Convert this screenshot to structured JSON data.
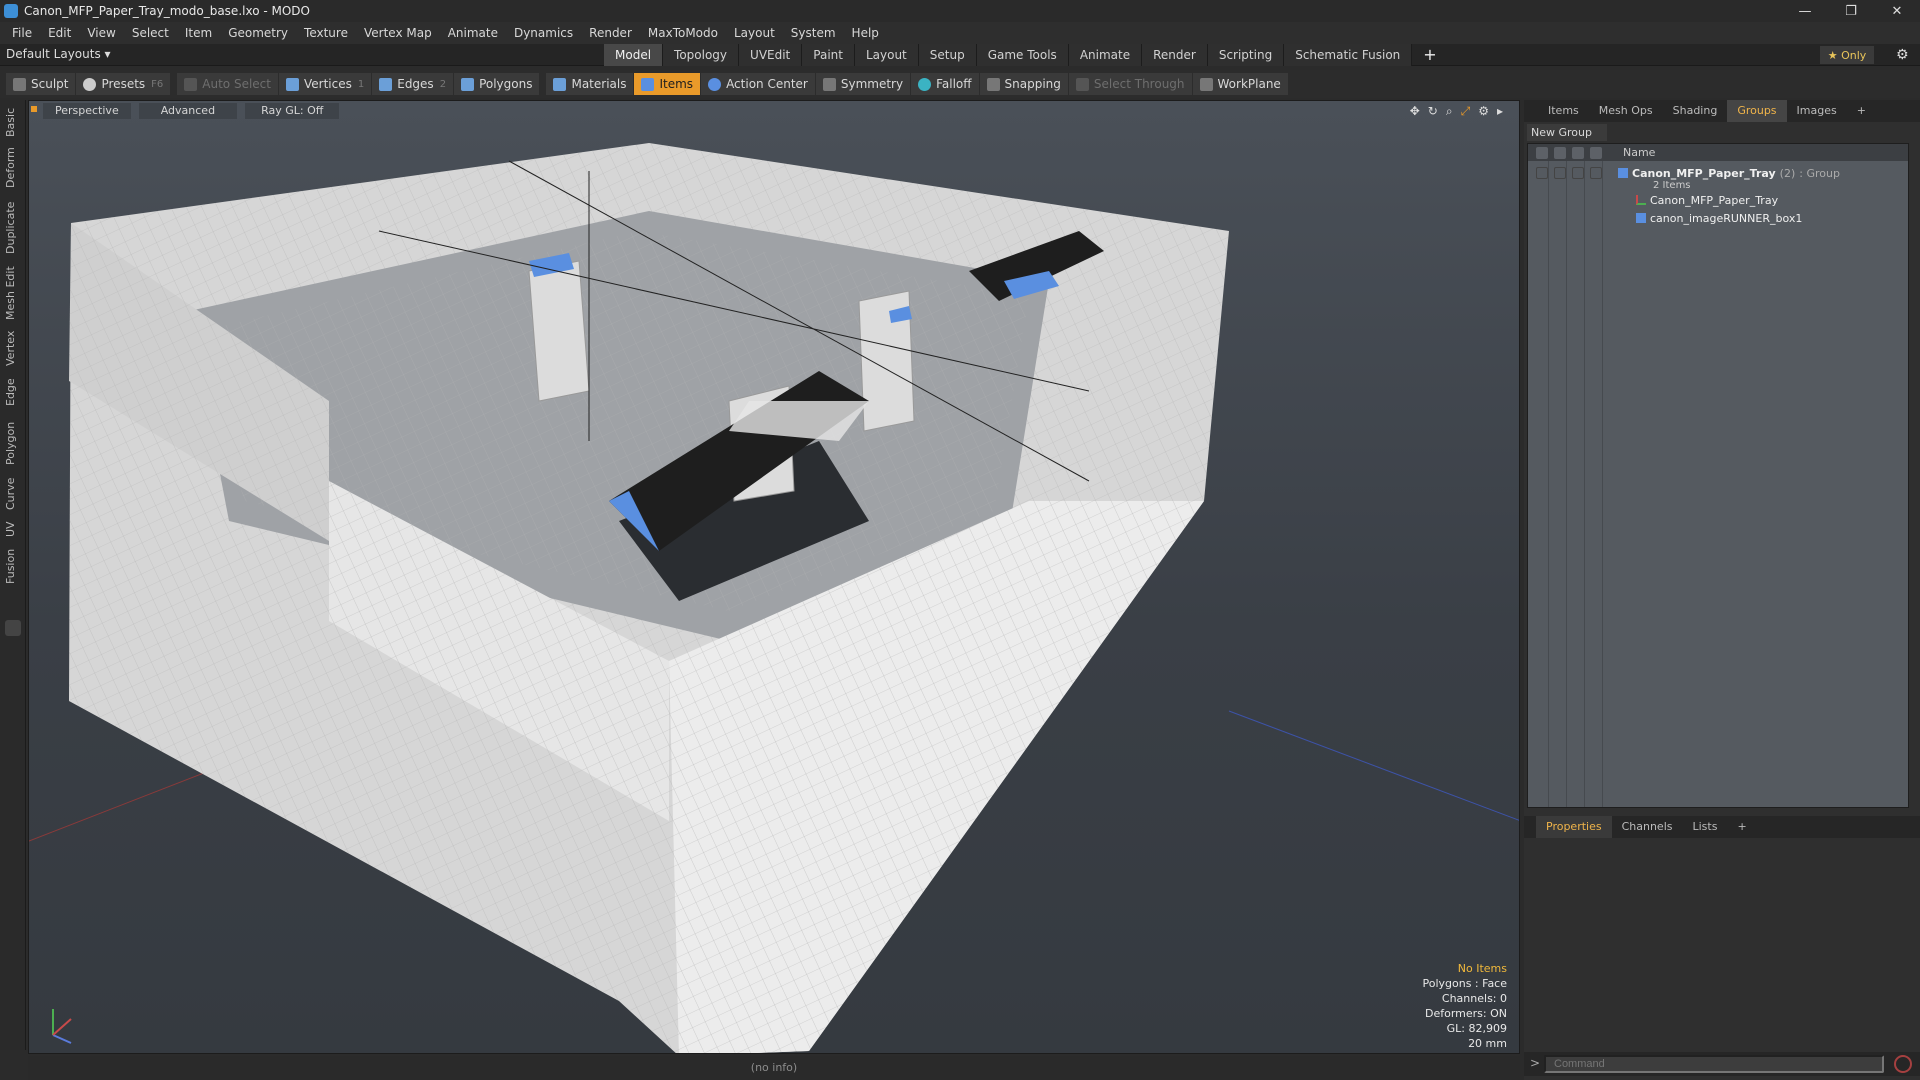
{
  "window": {
    "title": "Canon_MFP_Paper_Tray_modo_base.lxo - MODO",
    "controls": [
      "—",
      "❐",
      "✕"
    ]
  },
  "menu": [
    "File",
    "Edit",
    "View",
    "Select",
    "Item",
    "Geometry",
    "Texture",
    "Vertex Map",
    "Animate",
    "Dynamics",
    "Render",
    "MaxToModo",
    "Layout",
    "System",
    "Help"
  ],
  "layout_selector": "Default Layouts ▾",
  "tabs": [
    {
      "label": "Model",
      "active": true
    },
    {
      "label": "Topology"
    },
    {
      "label": "UVEdit"
    },
    {
      "label": "Paint"
    },
    {
      "label": "Layout"
    },
    {
      "label": "Setup"
    },
    {
      "label": "Game Tools"
    },
    {
      "label": "Animate"
    },
    {
      "label": "Render"
    },
    {
      "label": "Scripting"
    },
    {
      "label": "Schematic Fusion"
    }
  ],
  "tabs_plus": "+",
  "only_btn": "★ Only",
  "toolbar": {
    "sculpt": "Sculpt",
    "presets": "Presets",
    "presets_key": "F6",
    "auto_select": "Auto Select",
    "vertices": "Vertices",
    "vertices_key": "1",
    "edges": "Edges",
    "edges_key": "2",
    "polygons": "Polygons",
    "materials": "Materials",
    "items": "Items",
    "action_center": "Action Center",
    "symmetry": "Symmetry",
    "falloff": "Falloff",
    "snapping": "Snapping",
    "select_through": "Select Through",
    "workplane": "WorkPlane"
  },
  "left_tabs": [
    "Basic",
    "Deform",
    "Duplicate",
    "Mesh Edit",
    "Vertex",
    "Edge",
    "Polygon",
    "Curve",
    "UV",
    "Fusion"
  ],
  "viewport": {
    "view_mode": "Perspective",
    "advanced": "Advanced",
    "raygl": "Ray GL: Off",
    "info": {
      "items": "No Items",
      "polygons": "Polygons : Face",
      "channels": "Channels: 0",
      "deformers": "Deformers: ON",
      "gl": "GL: 82,909",
      "scale": "20 mm"
    }
  },
  "status": "(no info)",
  "right_panel": {
    "tabs": [
      "Items",
      "Mesh Ops",
      "Shading",
      "Groups",
      "Images"
    ],
    "active_tab": "Groups",
    "tabs_plus": "+",
    "new_group": "New Group",
    "column_name": "Name",
    "group": {
      "name": "Canon_MFP_Paper_Tray",
      "count": "(2)",
      "type": ": Group",
      "sub": "2 Items"
    },
    "children": [
      "Canon_MFP_Paper_Tray",
      "canon_imageRUNNER_box1"
    ],
    "prop_tabs": [
      "Properties",
      "Channels",
      "Lists"
    ],
    "prop_active": "Properties",
    "command_placeholder": "Command"
  },
  "colors": {
    "accent": "#e99a2a",
    "selection_blue": "#5a8fe0",
    "viewport_bg": "#3f444b"
  }
}
